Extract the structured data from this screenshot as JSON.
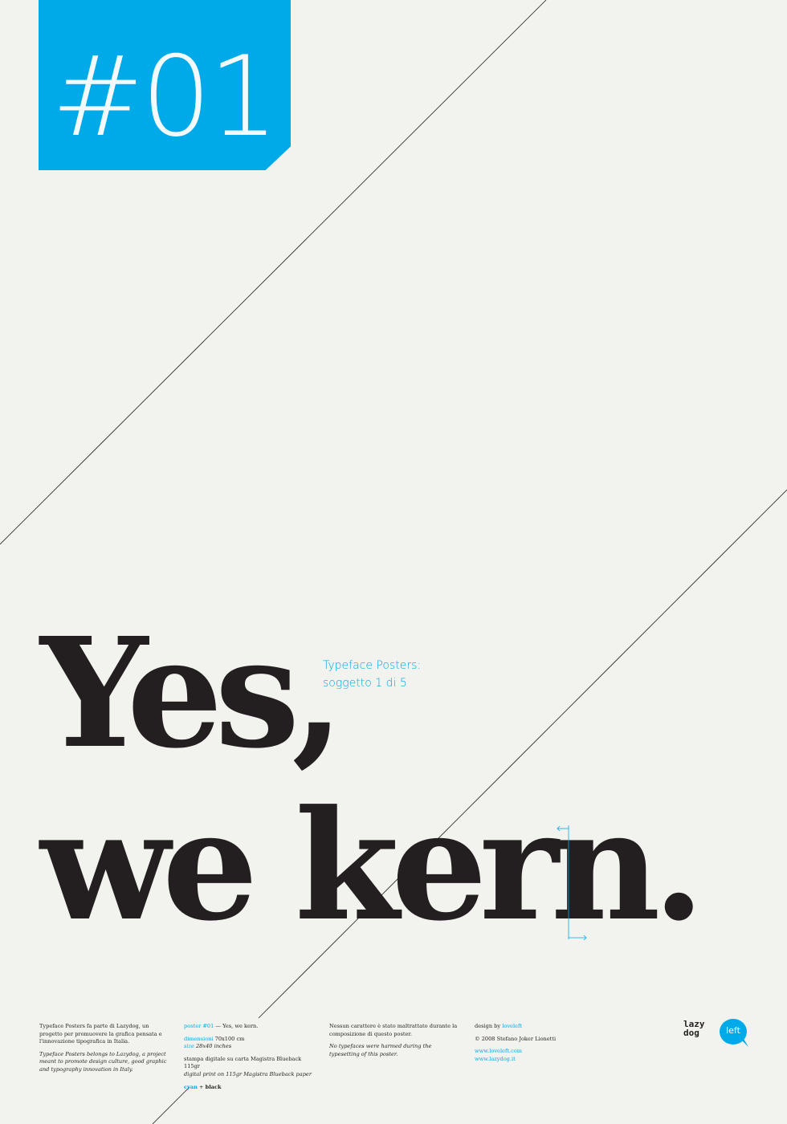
{
  "badge": {
    "number": "#01"
  },
  "headline": {
    "line1": "Yes,",
    "line2": "we kern."
  },
  "subtitle": {
    "line1": "Typeface Posters:",
    "line2": "soggetto 1 di 5"
  },
  "footer": {
    "col1": {
      "it_text": "Typeface Posters fa parte di Lazydog, un progetto per promuovere la grafica pensata e l'innovazione tipografica in Italia.",
      "en_text": "Typeface Posters belongs to Lazydog, a project meant to promote design culture, good graphic and typography innovation in Italy."
    },
    "col2": {
      "poster_label": "poster #01",
      "poster_title": "— Yes, we kern.",
      "dim_label": "dimensioni",
      "dim_value": "70x100 cm",
      "size_label": "size",
      "size_value": "28x40 inches",
      "print_it": "stampa digitale su carta Magistra Blueback 115gr",
      "print_en": "digital print on 115gr Magistra Blueback paper",
      "color_cyan": "cyan",
      "color_sep": " + ",
      "color_black": "black"
    },
    "col3": {
      "it_text": "Nessun carattere è stato maltrattato durante la composizione di questo poster.",
      "en_text": "No typefaces were harmed during the typesetting of this poster."
    },
    "col4": {
      "design_label": "design by ",
      "design_name": "loveleft",
      "copyright": "© 2008 Stefano Joker Lionetti",
      "link1": "www.loveleft.com",
      "link2": "www.lazydog.it"
    }
  },
  "logos": {
    "lazydog_line1": "lazy",
    "lazydog_line2": "dog",
    "left": "left"
  },
  "colors": {
    "accent": "#00a9e8",
    "ink": "#231f20",
    "paper": "#f2f2ee"
  }
}
